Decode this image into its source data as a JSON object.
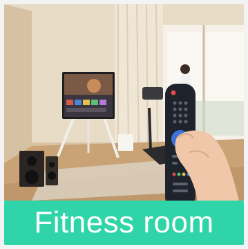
{
  "banner": {
    "label": "Fitness room",
    "background": "#2fd4a8",
    "text_color": "#ffffff"
  },
  "scene": {
    "icons": [
      "tv-icon",
      "speaker-icon",
      "treadmill-icon",
      "remote-control-icon",
      "hand-icon",
      "window-icon",
      "curtain-icon"
    ]
  }
}
